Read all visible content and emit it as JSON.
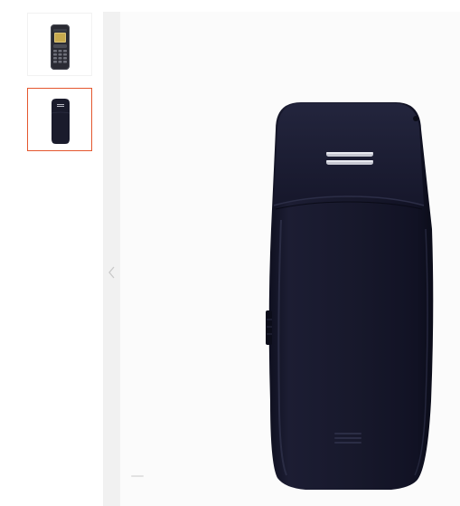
{
  "gallery": {
    "thumbnails": [
      {
        "icon": "phone-front-icon",
        "selected": false,
        "border_color": "#f2f2f2"
      },
      {
        "icon": "phone-back-icon",
        "selected": true,
        "border_color": "#e4572e"
      }
    ],
    "prev_icon": "chevron-left-icon",
    "main_image_icon": "phone-back-icon",
    "colors": {
      "rail": "#f1f1f1",
      "selected_border": "#e4572e",
      "phone_body": "#16172a"
    }
  }
}
